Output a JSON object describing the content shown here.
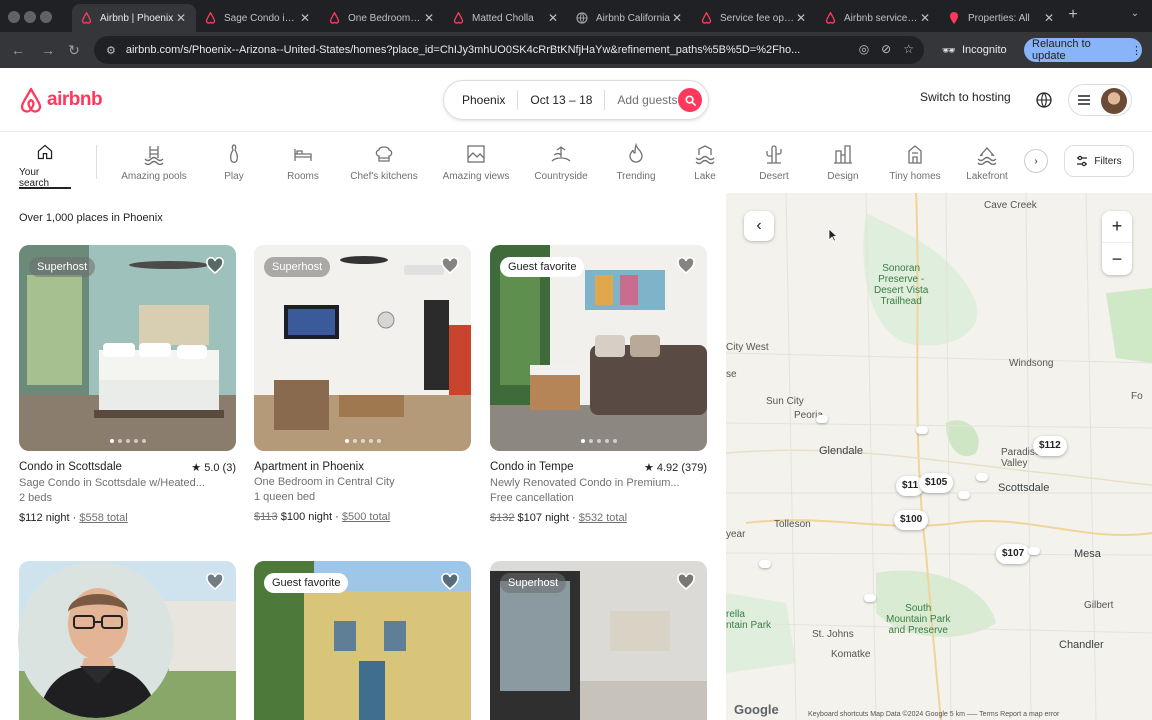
{
  "browser": {
    "tabs": [
      {
        "title": "Airbnb | Phoenix",
        "active": true
      },
      {
        "title": "Sage Condo in Scottsdale"
      },
      {
        "title": "One Bedroom in Central City"
      },
      {
        "title": "Matted Cholla"
      },
      {
        "title": "Airbnb California"
      },
      {
        "title": "Service fee options"
      },
      {
        "title": "Airbnb service fees"
      },
      {
        "title": "Properties: All"
      }
    ],
    "url": "airbnb.com/s/Phoenix--Arizona--United-States/homes?place_id=ChIJy3mhUO0SK4cRrBtKNfjHaYw&refinement_paths%5B%5D=%2Fho...",
    "incognito": "Incognito",
    "relaunch": "Relaunch to update"
  },
  "header": {
    "brand": "airbnb",
    "search": {
      "location": "Phoenix",
      "dates": "Oct 13 – 18",
      "guests": "Add guests"
    },
    "switch_hosting": "Switch to hosting"
  },
  "categories": {
    "items": [
      {
        "label": "Your search",
        "icon": "home-icon"
      },
      {
        "label": "Amazing pools",
        "icon": "pool-icon"
      },
      {
        "label": "Play",
        "icon": "bowling-icon"
      },
      {
        "label": "Rooms",
        "icon": "bed-icon"
      },
      {
        "label": "Chef's kitchens",
        "icon": "chef-hat-icon"
      },
      {
        "label": "Amazing views",
        "icon": "view-icon"
      },
      {
        "label": "Countryside",
        "icon": "countryside-icon"
      },
      {
        "label": "Trending",
        "icon": "flame-icon"
      },
      {
        "label": "Lake",
        "icon": "lake-icon"
      },
      {
        "label": "Desert",
        "icon": "cactus-icon"
      },
      {
        "label": "Design",
        "icon": "design-icon"
      },
      {
        "label": "Tiny homes",
        "icon": "tiny-home-icon"
      },
      {
        "label": "Lakefront",
        "icon": "lakefront-icon"
      }
    ],
    "filters": "Filters"
  },
  "results": {
    "count": "Over 1,000 places in Phoenix",
    "listings": [
      {
        "badge": "Superhost",
        "title": "Condo in Scottsdale",
        "rating": "★ 5.0 (3)",
        "sub1": "Sage Condo in Scottsdale w/Heated...",
        "sub2": "2 beds",
        "old_price": "",
        "price": "$112 night",
        "sep": " · ",
        "total": "$558 total"
      },
      {
        "badge": "Superhost",
        "title": "Apartment in Phoenix",
        "rating": "",
        "sub1": "One Bedroom in Central City",
        "sub2": "1 queen bed",
        "old_price": "$113",
        "price": " $100 night",
        "sep": " · ",
        "total": "$500 total"
      },
      {
        "badge": "Guest favorite",
        "title": "Condo in Tempe",
        "rating": "★ 4.92 (379)",
        "sub1": "Newly Renovated Condo in Premium...",
        "sub2": "Free cancellation",
        "old_price": "$132",
        "price": " $107 night",
        "sep": " · ",
        "total": "$532 total"
      },
      {
        "badge": ""
      },
      {
        "badge": "Guest favorite"
      },
      {
        "badge": "Superhost"
      }
    ]
  },
  "map": {
    "places": {
      "cave_creek": "Cave Creek",
      "sonoran": "Sonoran\nPreserve -\nDesert Vista\nTrailhead",
      "city_west": "City West",
      "sun_city": "Sun City",
      "peoria": "Peoria",
      "windsong": "Windsong",
      "glendale": "Glendale",
      "paradise_valley": "Paradise\nValley",
      "scottsdale": "Scottsdale",
      "tolleson": "Tolleson",
      "mesa": "Mesa",
      "south_mountain": "South\nMountain Park\nand Preserve",
      "st_johns": "St. Johns",
      "gilbert": "Gilbert",
      "chandler": "Chandler",
      "komatke": "Komatke",
      "estrella": "rella\nntain Park",
      "goodyear": "year",
      "fo": "Fo",
      "se": "se"
    },
    "pins": [
      "$112",
      "$11",
      "$105",
      "$100",
      "$107"
    ],
    "google": "Google",
    "attribution": "Keyboard shortcuts   Map Data ©2024 Google   5 km ⎯⎯⎯   Terms   Report a map error"
  },
  "colors": {
    "brand": "#ff385c",
    "chrome_dark": "#202124"
  }
}
